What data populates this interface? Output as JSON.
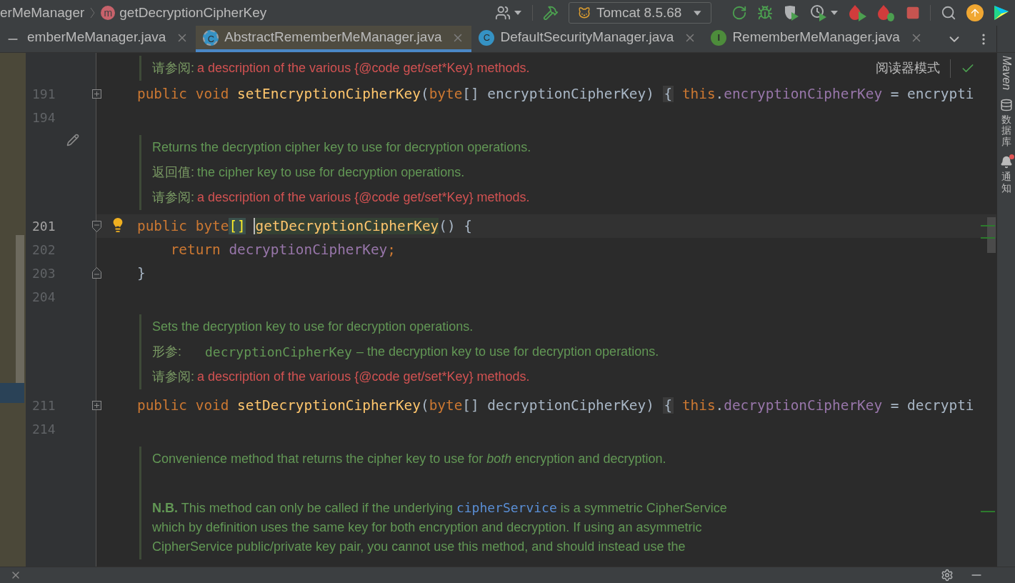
{
  "breadcrumb": [
    {
      "text": "erMeManager"
    },
    {
      "icon": "m",
      "text": "getDecryptionCipherKey"
    }
  ],
  "run_config": {
    "label": "Tomcat 8.5.68"
  },
  "tabs": [
    {
      "label": "emberMeManager.java",
      "selected": false
    },
    {
      "icon": "C",
      "kind": "abstract-class",
      "label": "AbstractRememberMeManager.java",
      "selected": true
    },
    {
      "icon": "C",
      "kind": "class",
      "label": "DefaultSecurityManager.java",
      "selected": false
    },
    {
      "icon": "I",
      "kind": "interface",
      "label": "RememberMeManager.java",
      "selected": false
    }
  ],
  "reader_mode": {
    "label": "阅读器模式"
  },
  "editor": {
    "lines": [
      {
        "kind": "doc",
        "items": [
          {
            "kind": "see",
            "label": "请参阅:",
            "text": "a description of the various {@code get/set*Key} methods."
          }
        ]
      },
      {
        "kind": "code",
        "number": "191",
        "fold_marker": {
          "kind": "expand"
        },
        "current": false,
        "tokens": [
          {
            "kind": "keyword",
            "text": "public void "
          },
          {
            "kind": "method",
            "text": "setEncryptionCipherKey"
          },
          {
            "kind": "plain",
            "text": "("
          },
          {
            "kind": "keyword",
            "text": "byte"
          },
          {
            "kind": "plain",
            "text": "[] encryptionCipherKey) "
          },
          {
            "kind": "fold",
            "text": "{"
          },
          {
            "kind": "keyword",
            "text": " this"
          },
          {
            "kind": "plain",
            "text": "."
          },
          {
            "kind": "field",
            "text": "encryptionCipherKey"
          },
          {
            "kind": "plain",
            "text": " = encrypti"
          }
        ]
      },
      {
        "kind": "code",
        "number": "194",
        "current": false
      },
      {
        "kind": "doc",
        "gutter_marker": {
          "kind": "pencil"
        },
        "items": [
          {
            "kind": "text",
            "lines": [
              [
                {
                  "kind": "text",
                  "text": "Returns the decryption cipher key to use for decryption operations."
                }
              ]
            ]
          },
          {
            "kind": "return",
            "label": "返回值:",
            "text": "the cipher key to use for decryption operations."
          },
          {
            "kind": "see",
            "label": "请参阅:",
            "text": "a description of the various {@code get/set*Key} methods."
          }
        ]
      },
      {
        "kind": "code",
        "number": "201",
        "fold_marker": {
          "kind": "collapse"
        },
        "gutter_marker": {
          "kind": "bulb"
        },
        "current": true,
        "tokens": [
          {
            "kind": "keyword",
            "text": "public byte"
          },
          {
            "kind": "match",
            "text": "[]"
          },
          {
            "kind": "usage",
            "text": "getDecryptionCipherKey"
          },
          {
            "kind": "plain",
            "text": "() {"
          }
        ]
      },
      {
        "kind": "code",
        "number": "202",
        "current": false,
        "tokens": [
          {
            "kind": "keyword",
            "text": "    return "
          },
          {
            "kind": "field",
            "text": "decryptionCipherKey"
          },
          {
            "kind": "keyword",
            "text": ";"
          }
        ]
      },
      {
        "kind": "code",
        "number": "203",
        "fold_marker": {
          "kind": "end"
        },
        "current": false,
        "tokens": [
          {
            "kind": "plain",
            "text": "}"
          }
        ]
      },
      {
        "kind": "code",
        "number": "204",
        "current": false
      },
      {
        "kind": "doc",
        "items": [
          {
            "kind": "text",
            "lines": [
              [
                {
                  "kind": "text",
                  "text": "Sets the decryption key to use for decryption operations."
                }
              ]
            ]
          },
          {
            "kind": "param",
            "label": "形参:",
            "name": "decryptionCipherKey",
            "text": "– the decryption key to use for decryption operations."
          },
          {
            "kind": "see",
            "label": "请参阅:",
            "text": "a description of the various {@code get/set*Key} methods."
          }
        ]
      },
      {
        "kind": "code",
        "number": "211",
        "fold_marker": {
          "kind": "expand"
        },
        "current": false,
        "tokens": [
          {
            "kind": "keyword",
            "text": "public void "
          },
          {
            "kind": "method",
            "text": "setDecryptionCipherKey"
          },
          {
            "kind": "plain",
            "text": "("
          },
          {
            "kind": "keyword",
            "text": "byte"
          },
          {
            "kind": "plain",
            "text": "[] decryptionCipherKey) "
          },
          {
            "kind": "fold",
            "text": "{"
          },
          {
            "kind": "keyword",
            "text": " this"
          },
          {
            "kind": "plain",
            "text": "."
          },
          {
            "kind": "field",
            "text": "decryptionCipherKey"
          },
          {
            "kind": "plain",
            "text": " = decrypti"
          }
        ]
      },
      {
        "kind": "code",
        "number": "214",
        "current": false
      },
      {
        "kind": "doc",
        "items": [
          {
            "kind": "text",
            "lines": [
              [
                {
                  "kind": "text",
                  "text": "Convenience method that returns the cipher key to use for *both* encryption and decryption."
                }
              ]
            ]
          },
          {
            "kind": "text",
            "lines": [
              [
                {
                  "kind": "text",
                  "text": "**N.B.** This method can only be called if the underlying "
                },
                {
                  "kind": "code",
                  "text": "cipherService"
                },
                {
                  "kind": "text",
                  "text": " is a symmetric CipherService"
                }
              ],
              [
                {
                  "kind": "text",
                  "text": "which by definition uses the same key for both encryption and decryption. If using an asymmetric"
                }
              ],
              [
                {
                  "kind": "text",
                  "text": "CipherService public/private key pair, you cannot use this method, and should instead use the"
                }
              ]
            ]
          }
        ]
      }
    ]
  },
  "tool_strip": [
    {
      "kind": "maven",
      "label": "Maven"
    },
    {
      "kind": "database",
      "label": "数据库"
    },
    {
      "kind": "notifications",
      "label": "通知",
      "unread": true
    }
  ]
}
